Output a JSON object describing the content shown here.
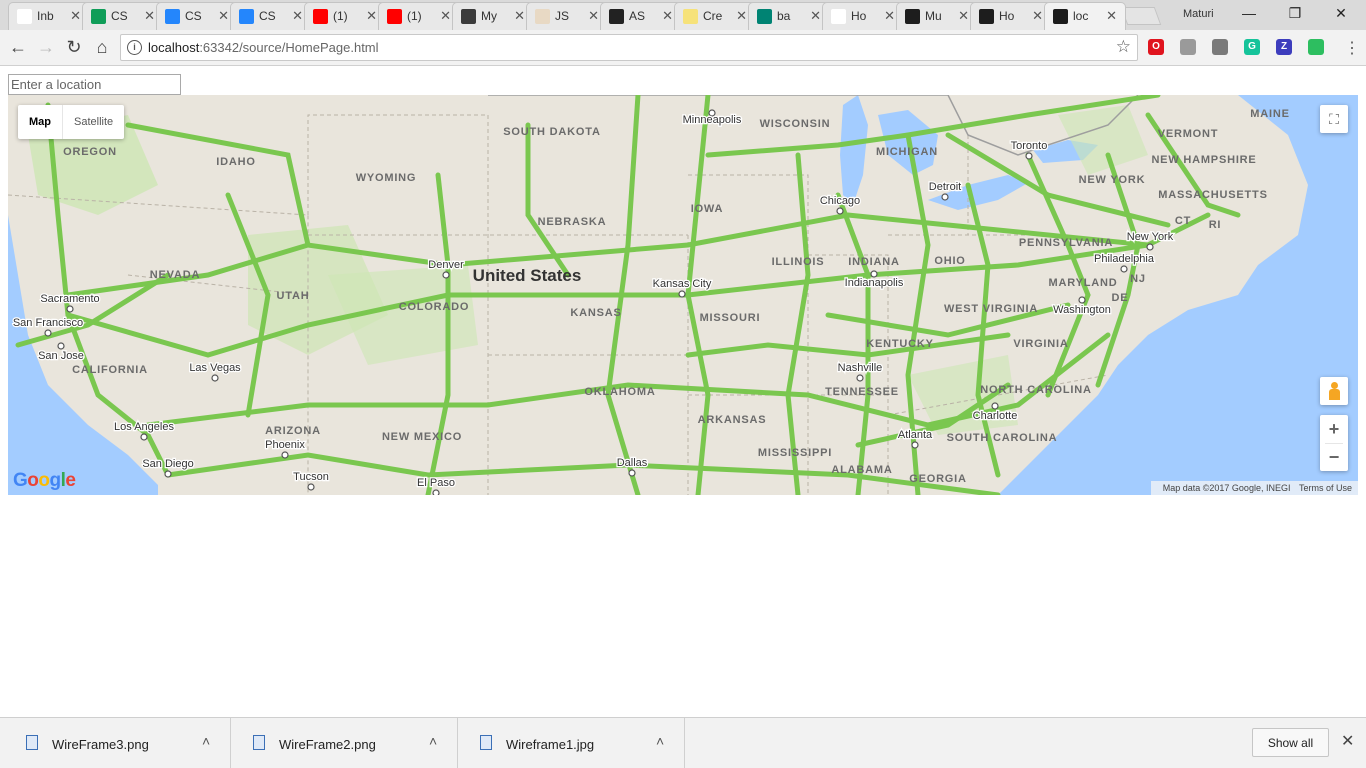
{
  "browser": {
    "tabs": [
      {
        "title": "Inb",
        "favicon": "gmail-icon",
        "color": "#ffffff"
      },
      {
        "title": "CS",
        "favicon": "sheets-icon",
        "color": "#0f9d58"
      },
      {
        "title": "CS",
        "favicon": "box-icon",
        "color": "#2486fc"
      },
      {
        "title": "CS",
        "favicon": "box-icon",
        "color": "#2486fc"
      },
      {
        "title": "(1)",
        "favicon": "youtube-icon",
        "color": "#ff0000"
      },
      {
        "title": "(1)",
        "favicon": "youtube-icon",
        "color": "#ff0000"
      },
      {
        "title": "My",
        "favicon": "blackboard-icon",
        "color": "#3b3b3b"
      },
      {
        "title": "JS",
        "favicon": "jsbin-icon",
        "color": "#e8d9c4"
      },
      {
        "title": "AS",
        "favicon": "github-icon",
        "color": "#222222"
      },
      {
        "title": "Cre",
        "favicon": "bulb-icon",
        "color": "#f6e27a"
      },
      {
        "title": "ba",
        "favicon": "bing-icon",
        "color": "#008373"
      },
      {
        "title": "Ho",
        "favicon": "page-icon",
        "color": "#ffffff"
      },
      {
        "title": "Mu",
        "favicon": "webstorm-icon",
        "color": "#1d1d1d"
      },
      {
        "title": "Ho",
        "favicon": "webstorm-icon",
        "color": "#1d1d1d"
      },
      {
        "title": "loc",
        "favicon": "webstorm-icon",
        "color": "#1d1d1d"
      }
    ],
    "profile_name": "Maturi",
    "url_host": "localhost",
    "url_rest": ":63342/source/HomePage.html",
    "extensions": [
      {
        "name": "opera-icon",
        "label": "O",
        "color": "#e0141e"
      },
      {
        "name": "shield-icon",
        "label": "",
        "color": "#9a9a9a"
      },
      {
        "name": "card-icon",
        "label": "",
        "color": "#7a7a7a"
      },
      {
        "name": "grammarly-icon",
        "label": "G",
        "color": "#15c39a"
      },
      {
        "name": "z-extension-icon",
        "label": "Z",
        "color": "#3d3dbd"
      },
      {
        "name": "evernote-icon",
        "label": "",
        "color": "#2dbe60"
      }
    ]
  },
  "page": {
    "location_placeholder": "Enter a location"
  },
  "map": {
    "type_map": "Map",
    "type_satellite": "Satellite",
    "google_logo": "Google",
    "attribution": "Map data ©2017 Google, INEGI",
    "terms": "Terms of Use",
    "country_label": "United States",
    "states": [
      "OREGON",
      "IDAHO",
      "WYOMING",
      "SOUTH DAKOTA",
      "NEBRASKA",
      "IOWA",
      "WISCONSIN",
      "MICHIGAN",
      "NEVADA",
      "UTAH",
      "COLORADO",
      "KANSAS",
      "MISSOURI",
      "ILLINOIS",
      "INDIANA",
      "OHIO",
      "PENNSYLVANIA",
      "NEW YORK",
      "VERMONT",
      "NEW HAMPSHIRE",
      "MASSACHUSETTS",
      "MAINE",
      "CT",
      "RI",
      "NJ",
      "MARYLAND",
      "DE",
      "WEST VIRGINIA",
      "VIRGINIA",
      "KENTUCKY",
      "TENNESSEE",
      "NORTH CAROLINA",
      "SOUTH CAROLINA",
      "GEORGIA",
      "ALABAMA",
      "MISSISSIPPI",
      "ARKANSAS",
      "OKLAHOMA",
      "NEW MEXICO",
      "ARIZONA",
      "CALIFORNIA"
    ],
    "cities": [
      "Minneapolis",
      "Toronto",
      "Detroit",
      "Chicago",
      "Denver",
      "Kansas City",
      "Indianapolis",
      "New York",
      "Philadelphia",
      "Washington",
      "Sacramento",
      "San Francisco",
      "San Jose",
      "Las Vegas",
      "Los Angeles",
      "San Diego",
      "Phoenix",
      "Tucson",
      "El Paso",
      "Dallas",
      "Nashville",
      "Charlotte",
      "Atlanta"
    ],
    "colors": {
      "land": "#e9e5dc",
      "water": "#a3ccff",
      "park": "#cde6b4",
      "traffic": "#7ac74f"
    }
  },
  "downloads": {
    "items": [
      {
        "name": "WireFrame3.png"
      },
      {
        "name": "WireFrame2.png"
      },
      {
        "name": "Wireframe1.jpg"
      }
    ],
    "show_all": "Show all"
  }
}
